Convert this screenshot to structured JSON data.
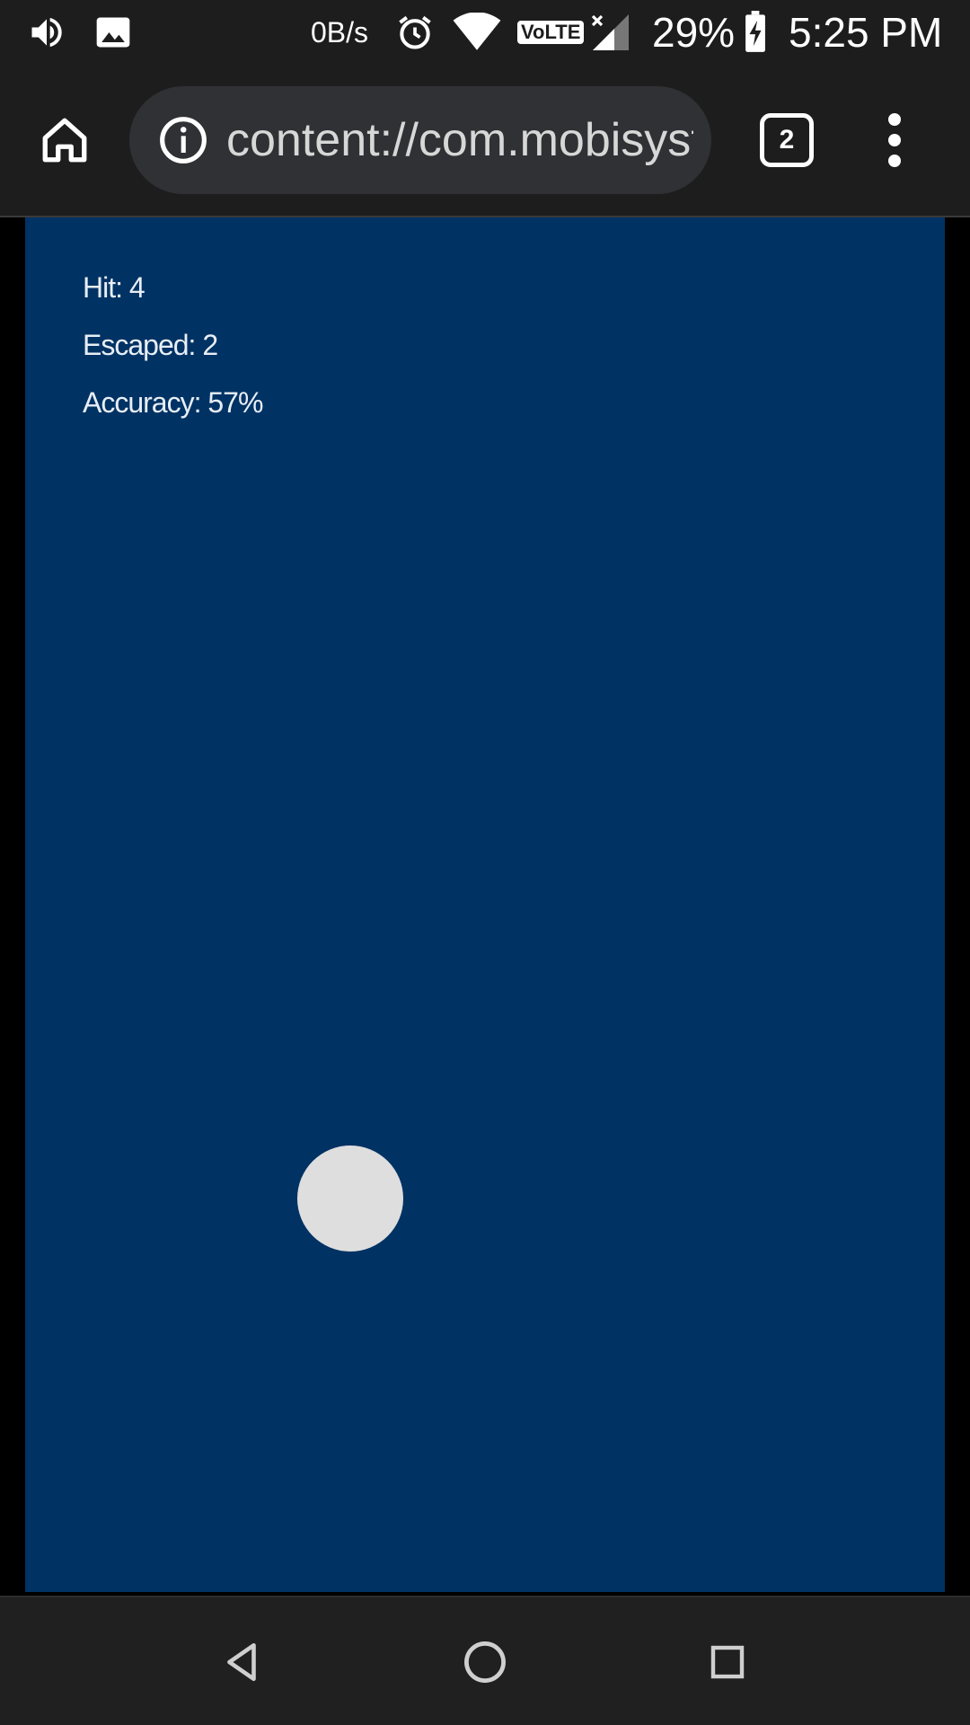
{
  "status_bar": {
    "net_speed": "0B/s",
    "volte": "VoLTE",
    "battery_percent": "29%",
    "time": "5:25 PM",
    "icons": [
      "volume-icon",
      "image-notification-icon",
      "alarm-icon",
      "wifi-icon",
      "volte-icon",
      "signal-icon",
      "battery-charging-icon"
    ]
  },
  "browser": {
    "url": "content://com.mobisystems.fileman",
    "tab_count": "2",
    "icons": [
      "home-icon",
      "info-icon",
      "tab-switcher-icon",
      "more-vert-icon"
    ]
  },
  "game": {
    "stats": {
      "hit": "Hit: 4",
      "escaped": "Escaped: 2",
      "accuracy": "Accuracy: 57%"
    },
    "colors": {
      "background": "#003264",
      "target": "#dedede",
      "text": "#e8eef5"
    }
  },
  "nav_bar": {
    "icons": [
      "back-icon",
      "home-nav-icon",
      "recents-icon"
    ]
  }
}
